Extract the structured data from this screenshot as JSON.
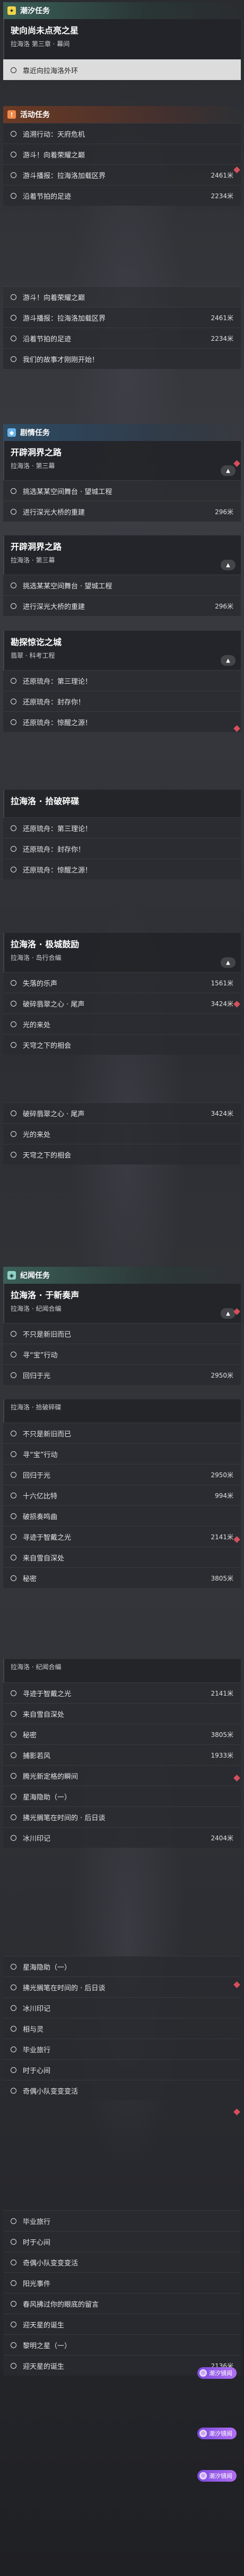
{
  "sections": {
    "tide": "潮汐任务",
    "event": "活动任务",
    "stream": "剧情任务",
    "echo": "纪闻任务",
    "fragment": "拉海洛 · 拾破碎碟"
  },
  "tide_quest": {
    "title": "驶向尚未点亮之星",
    "subtitle": "拉海洛 第三章 · 幕间",
    "objective": "靠近向拉海洛外环"
  },
  "event_quest_a": {
    "items": [
      {
        "label": "追溯行动：天府危机",
        "dist": ""
      },
      {
        "label": "游斗！向着荣耀之巅",
        "dist": ""
      },
      {
        "label": "游斗播报：拉海洛加载区界",
        "dist": "2461米"
      },
      {
        "label": "沿着节拍的足迹",
        "dist": "2234米"
      }
    ]
  },
  "event_quest_b": {
    "items": [
      {
        "label": "游斗！向着荣耀之巅",
        "dist": ""
      },
      {
        "label": "游斗播报：拉海洛加载区界",
        "dist": "2461米"
      },
      {
        "label": "沿着节拍的足迹",
        "dist": "2234米"
      },
      {
        "label": "我们的故事才刚刚开始！",
        "dist": ""
      }
    ]
  },
  "stream_a": {
    "title": "开辟洞界之路",
    "subtitle": "拉海洛 · 第三幕",
    "items": [
      {
        "label": "挑选某某空间舞台 · 望城工程",
        "dist": ""
      },
      {
        "label": "进行深光大桥的重建",
        "dist": "296米"
      }
    ]
  },
  "stream_b": {
    "title": "开辟洞界之路",
    "subtitle": "拉海洛 · 第三幕",
    "items": [
      {
        "label": "挑选某某空间舞台 · 望城工程",
        "dist": ""
      },
      {
        "label": "进行深光大桥的重建",
        "dist": "296米"
      }
    ]
  },
  "stream_c": {
    "title": "勘探惊讫之城",
    "subtitle": "翡翠 · 科考工程",
    "items": [
      {
        "label": "还原琉舟：第三理论！",
        "dist": ""
      },
      {
        "label": "还原琉舟：封存你！",
        "dist": ""
      },
      {
        "label": "还原琉舟：惊醒之源！",
        "dist": ""
      }
    ]
  },
  "stream_d": {
    "title": "拉海洛 · 拾破碎碟",
    "items": [
      {
        "label": "还原琉舟：第三理论！",
        "dist": ""
      },
      {
        "label": "还原琉舟：封存你！",
        "dist": ""
      },
      {
        "label": "还原琉舟：惊醒之源！",
        "dist": ""
      }
    ]
  },
  "stream_e": {
    "title": "拉海洛 · 极城鼓励",
    "subtitle": "拉海洛 · 岛行合编",
    "items": [
      {
        "label": "失落的乐声",
        "dist": "1561米"
      },
      {
        "label": "破碎翡翠之心 · 尾声",
        "dist": "3424米"
      },
      {
        "label": "光的来处",
        "dist": ""
      },
      {
        "label": "天穹之下的相会",
        "dist": ""
      }
    ]
  },
  "stream_f": {
    "items": [
      {
        "label": "破碎翡翠之心 · 尾声",
        "dist": "3424米"
      },
      {
        "label": "光的来处",
        "dist": ""
      },
      {
        "label": "天穹之下的相会",
        "dist": ""
      }
    ]
  },
  "echo_a": {
    "title": "拉海洛 · 于新奏声",
    "subtitle": "拉海洛 · 纪闻合编",
    "items": [
      {
        "label": "不只是新旧而已",
        "dist": ""
      },
      {
        "label": "寻“宝”行动",
        "dist": ""
      },
      {
        "label": "回归于光",
        "dist": "2950米"
      }
    ]
  },
  "echo_b": {
    "items": [
      {
        "label": "不只是新旧而已",
        "dist": ""
      },
      {
        "label": "寻“宝”行动",
        "dist": ""
      },
      {
        "label": "回归于光",
        "dist": "2950米"
      },
      {
        "label": "十六亿比特",
        "dist": "994米"
      },
      {
        "label": "破损奏鸣曲",
        "dist": ""
      },
      {
        "label": "寻迹于智戴之光",
        "dist": "2141米"
      },
      {
        "label": "来自雪自深处",
        "dist": ""
      },
      {
        "label": "秘密",
        "dist": "3805米"
      }
    ]
  },
  "echo_c": {
    "title": "拉海洛 · 纪闻合编",
    "items": [
      {
        "label": "寻迹于智戴之光",
        "dist": "2141米"
      },
      {
        "label": "来自雪自深处",
        "dist": ""
      },
      {
        "label": "秘密",
        "dist": "3805米"
      },
      {
        "label": "捕影若风",
        "dist": "1933米"
      },
      {
        "label": "腾光新定格的瞬间",
        "dist": ""
      },
      {
        "label": "星海隐助（一）",
        "dist": ""
      },
      {
        "label": "拂光搁笔在时间的 · 后日谈",
        "dist": ""
      },
      {
        "label": "冰川印记",
        "dist": "2404米"
      }
    ]
  },
  "echo_d": {
    "items": [
      {
        "label": "星海隐助（一）",
        "dist": ""
      },
      {
        "label": "拂光搁笔在时间的 · 后日谈",
        "dist": ""
      },
      {
        "label": "冰川印记",
        "dist": ""
      },
      {
        "label": "相与灵",
        "dist": ""
      },
      {
        "label": "毕业旅行",
        "dist": ""
      },
      {
        "label": "时于心间",
        "dist": ""
      },
      {
        "label": "奇偶小队变变变活",
        "dist": ""
      }
    ]
  },
  "echo_e": {
    "items": [
      {
        "label": "毕业旅行",
        "dist": ""
      },
      {
        "label": "时于心间",
        "dist": ""
      },
      {
        "label": "奇偶小队变变变活",
        "dist": ""
      },
      {
        "label": "阳光事件",
        "dist": ""
      },
      {
        "label": "春风拂过你的眼底的留言",
        "dist": ""
      },
      {
        "label": "迎天星的诞生",
        "dist": ""
      },
      {
        "label": "黎明之星（一）",
        "dist": ""
      },
      {
        "label": "迎天星的诞生",
        "dist": "2136米"
      }
    ]
  },
  "badge_label": "潮汐镜闻",
  "colors": {
    "tide": "#f1d54a",
    "event": "#f08a4b",
    "stream": "#6ab4ea",
    "marker": "#d5505a",
    "badge": "#9a5ce8"
  }
}
